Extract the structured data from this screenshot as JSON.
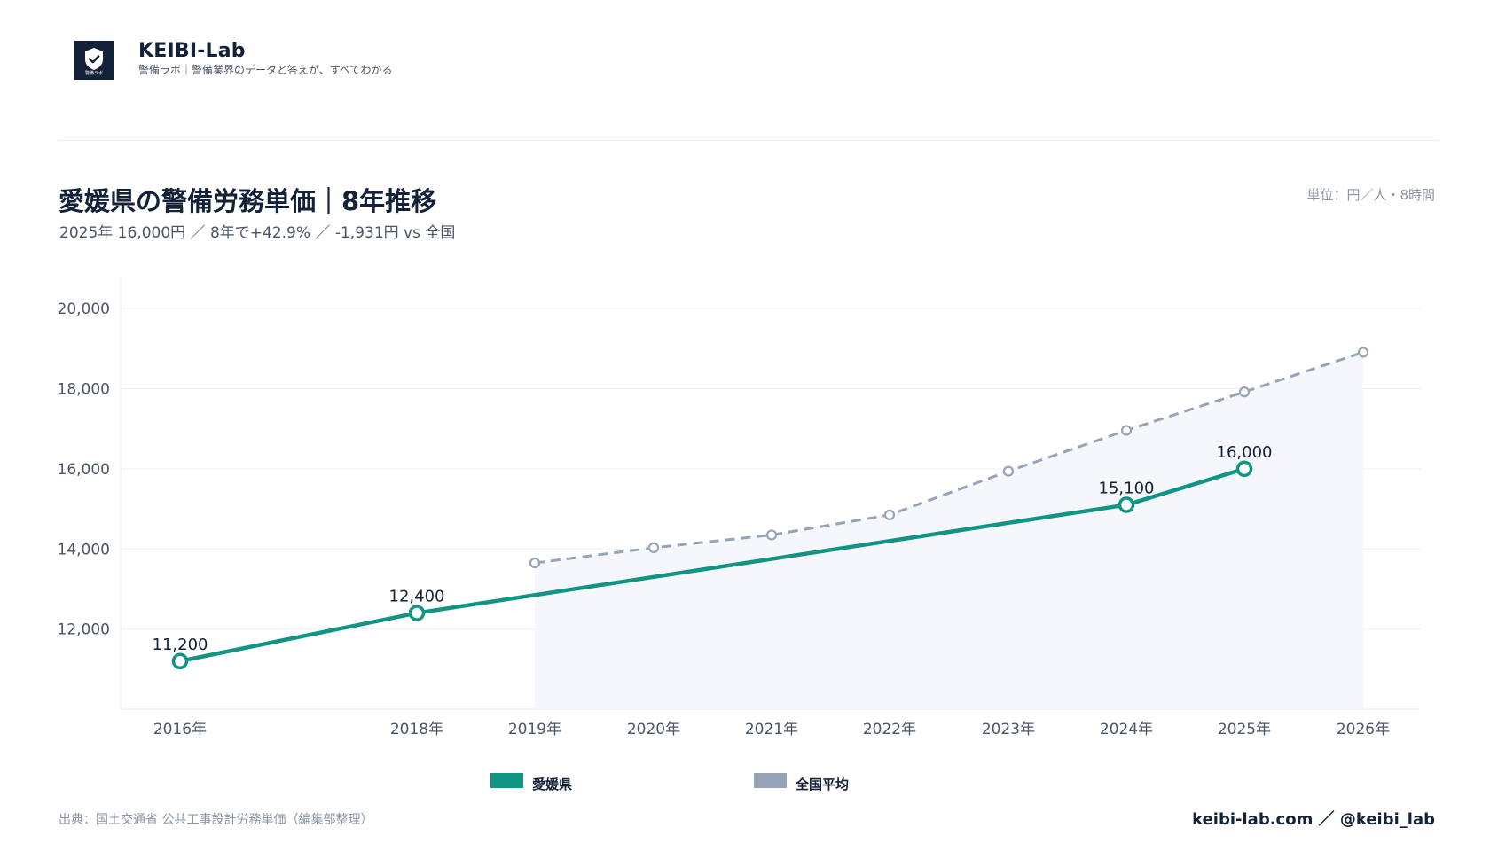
{
  "brand": {
    "name": "KEIBI-Lab",
    "tagline": "警備ラボ｜警備業界のデータと答えが、すべてわかる",
    "logo_text": "警備ラボ",
    "logo_icon": "shield-check-icon"
  },
  "header": {
    "title": "愛媛県の警備労務単価｜8年推移",
    "subtitle": "2025年 16,000円 ／ 8年で+42.9% ／ -1,931円 vs 全国",
    "unit": "単位：円／人・8時間"
  },
  "colors": {
    "primary": "#129485",
    "secondary": "#96a4b8",
    "area": "#f5f7fa",
    "text": "#132238",
    "muted": "#8a96a8"
  },
  "chart_data": {
    "type": "line",
    "x": [
      "2016年",
      "2018年",
      "2019年",
      "2020年",
      "2021年",
      "2022年",
      "2023年",
      "2024年",
      "2025年",
      "2026年"
    ],
    "ylim": [
      10000,
      20800
    ],
    "yticks": [
      "12,000",
      "14,000",
      "16,000",
      "18,000",
      "20,000"
    ],
    "grid": true,
    "legend_position": "bottom",
    "series": [
      {
        "name": "愛媛県",
        "style": "solid",
        "values": [
          11200,
          12400,
          null,
          null,
          null,
          null,
          null,
          15100,
          16000,
          null
        ],
        "labels": [
          "11,200",
          "12,400",
          null,
          null,
          null,
          null,
          null,
          "15,100",
          "16,000",
          null
        ]
      },
      {
        "name": "全国平均",
        "style": "dashed",
        "values": [
          null,
          null,
          13650,
          14030,
          14350,
          14850,
          15940,
          16960,
          17920,
          18910
        ]
      }
    ]
  },
  "legend": {
    "items": [
      {
        "label": "愛媛県",
        "color": "#129485"
      },
      {
        "label": "全国平均",
        "color": "#96a4b8"
      }
    ]
  },
  "footer": {
    "source": "出典：国土交通省 公共工事設計労務単価（編集部整理）",
    "credit": "keibi-lab.com ／ @keibi_lab"
  }
}
